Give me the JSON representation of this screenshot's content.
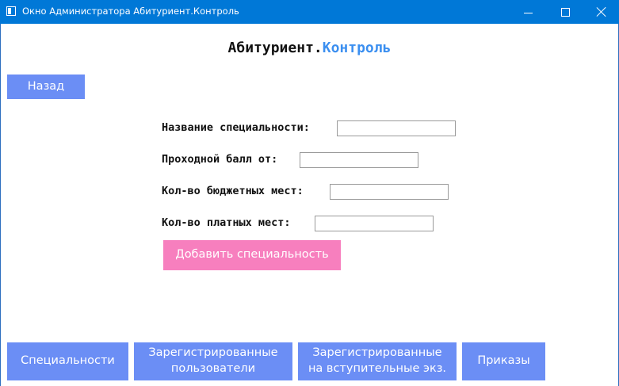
{
  "window": {
    "title": "Окно Администратора Абитуриент.Контроль",
    "minimize_icon": "minimize-icon",
    "maximize_icon": "maximize-icon",
    "close_icon": "close-icon"
  },
  "brand": {
    "part1": "Абитуриент.",
    "part2": "Контроль",
    "accent_color": "#3b8ff0"
  },
  "back_button": "Назад",
  "form": {
    "fields": [
      {
        "label": "Название специальности:",
        "value": ""
      },
      {
        "label": "Проходной балл от:",
        "value": ""
      },
      {
        "label": "Кол-во бюджетных мест:",
        "value": ""
      },
      {
        "label": "Кол-во платных мест:",
        "value": ""
      }
    ],
    "submit_label": "Добавить специальность",
    "submit_color": "#f77fbe"
  },
  "nav": {
    "color": "#6b8ef5",
    "buttons": [
      "Специальности",
      "Зарегистрированные\nпользователи",
      "Зарегистрированные\nна вступительные экз.",
      "Приказы"
    ]
  }
}
